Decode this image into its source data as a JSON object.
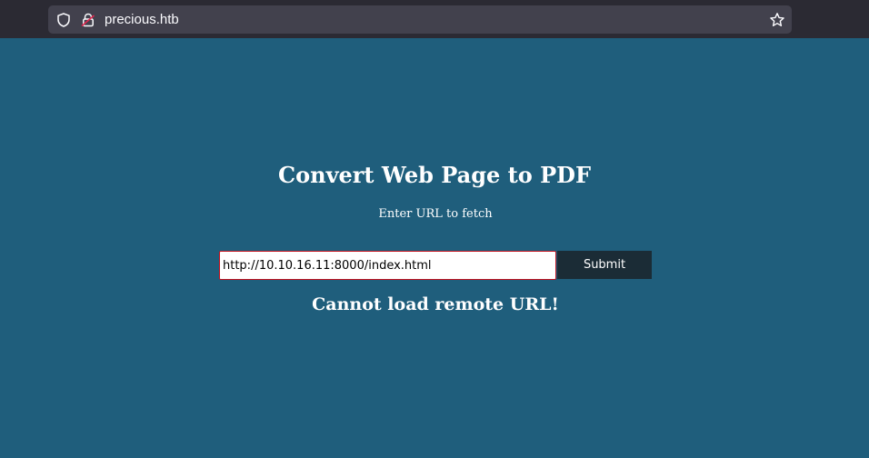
{
  "browser": {
    "url": "precious.htb",
    "icons": [
      "shield-icon",
      "lock-icon",
      "star-icon"
    ]
  },
  "main": {
    "title": "Convert Web Page to PDF",
    "subtitle": "Enter URL to fetch",
    "url_input_value": "http://10.10.16.11:8000/index.html",
    "submit_label": "Submit",
    "message": "Cannot load remote URL!"
  },
  "colors": {
    "page_background": "#1f5e7c",
    "button_background": "#1b2c36",
    "input_border": "#c1121f"
  }
}
